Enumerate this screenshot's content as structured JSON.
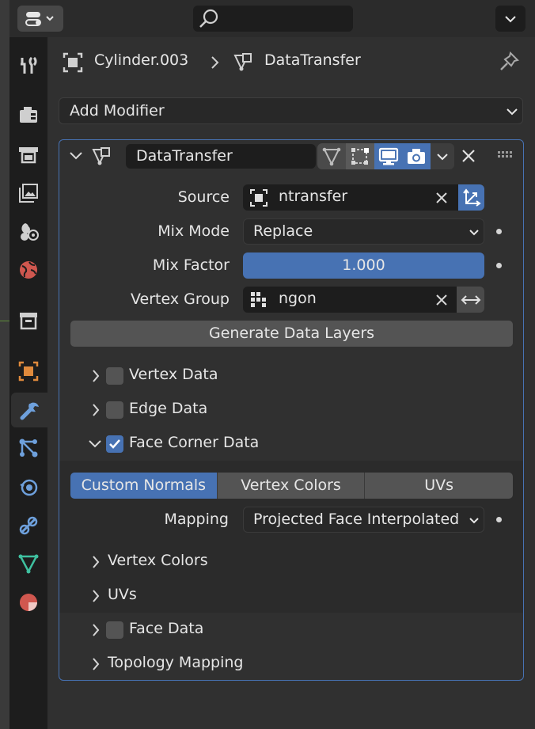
{
  "breadcrumb": {
    "object": "Cylinder.003",
    "modifier": "DataTransfer"
  },
  "add_modifier": "Add Modifier",
  "modifier": {
    "name": "DataTransfer",
    "source": {
      "label": "Source",
      "value": "ntransfer"
    },
    "mix_mode": {
      "label": "Mix Mode",
      "value": "Replace"
    },
    "mix_factor": {
      "label": "Mix Factor",
      "value": "1.000"
    },
    "vertex_group": {
      "label": "Vertex Group",
      "value": "ngon"
    },
    "generate_button": "Generate Data Layers",
    "sections": {
      "vertex_data": "Vertex Data",
      "edge_data": "Edge Data",
      "face_corner_data": "Face Corner Data",
      "face_data": "Face Data",
      "topology_mapping": "Topology Mapping"
    },
    "face_corner": {
      "tabs": [
        "Custom Normals",
        "Vertex Colors",
        "UVs"
      ],
      "active_tab": "Custom Normals",
      "mapping": {
        "label": "Mapping",
        "value": "Projected Face Interpolated"
      },
      "subpanels": {
        "vertex_colors": "Vertex Colors",
        "uvs": "UVs"
      }
    }
  },
  "colors": {
    "accent": "#4772b3",
    "panel": "#303030",
    "field": "#1d1d1d"
  }
}
